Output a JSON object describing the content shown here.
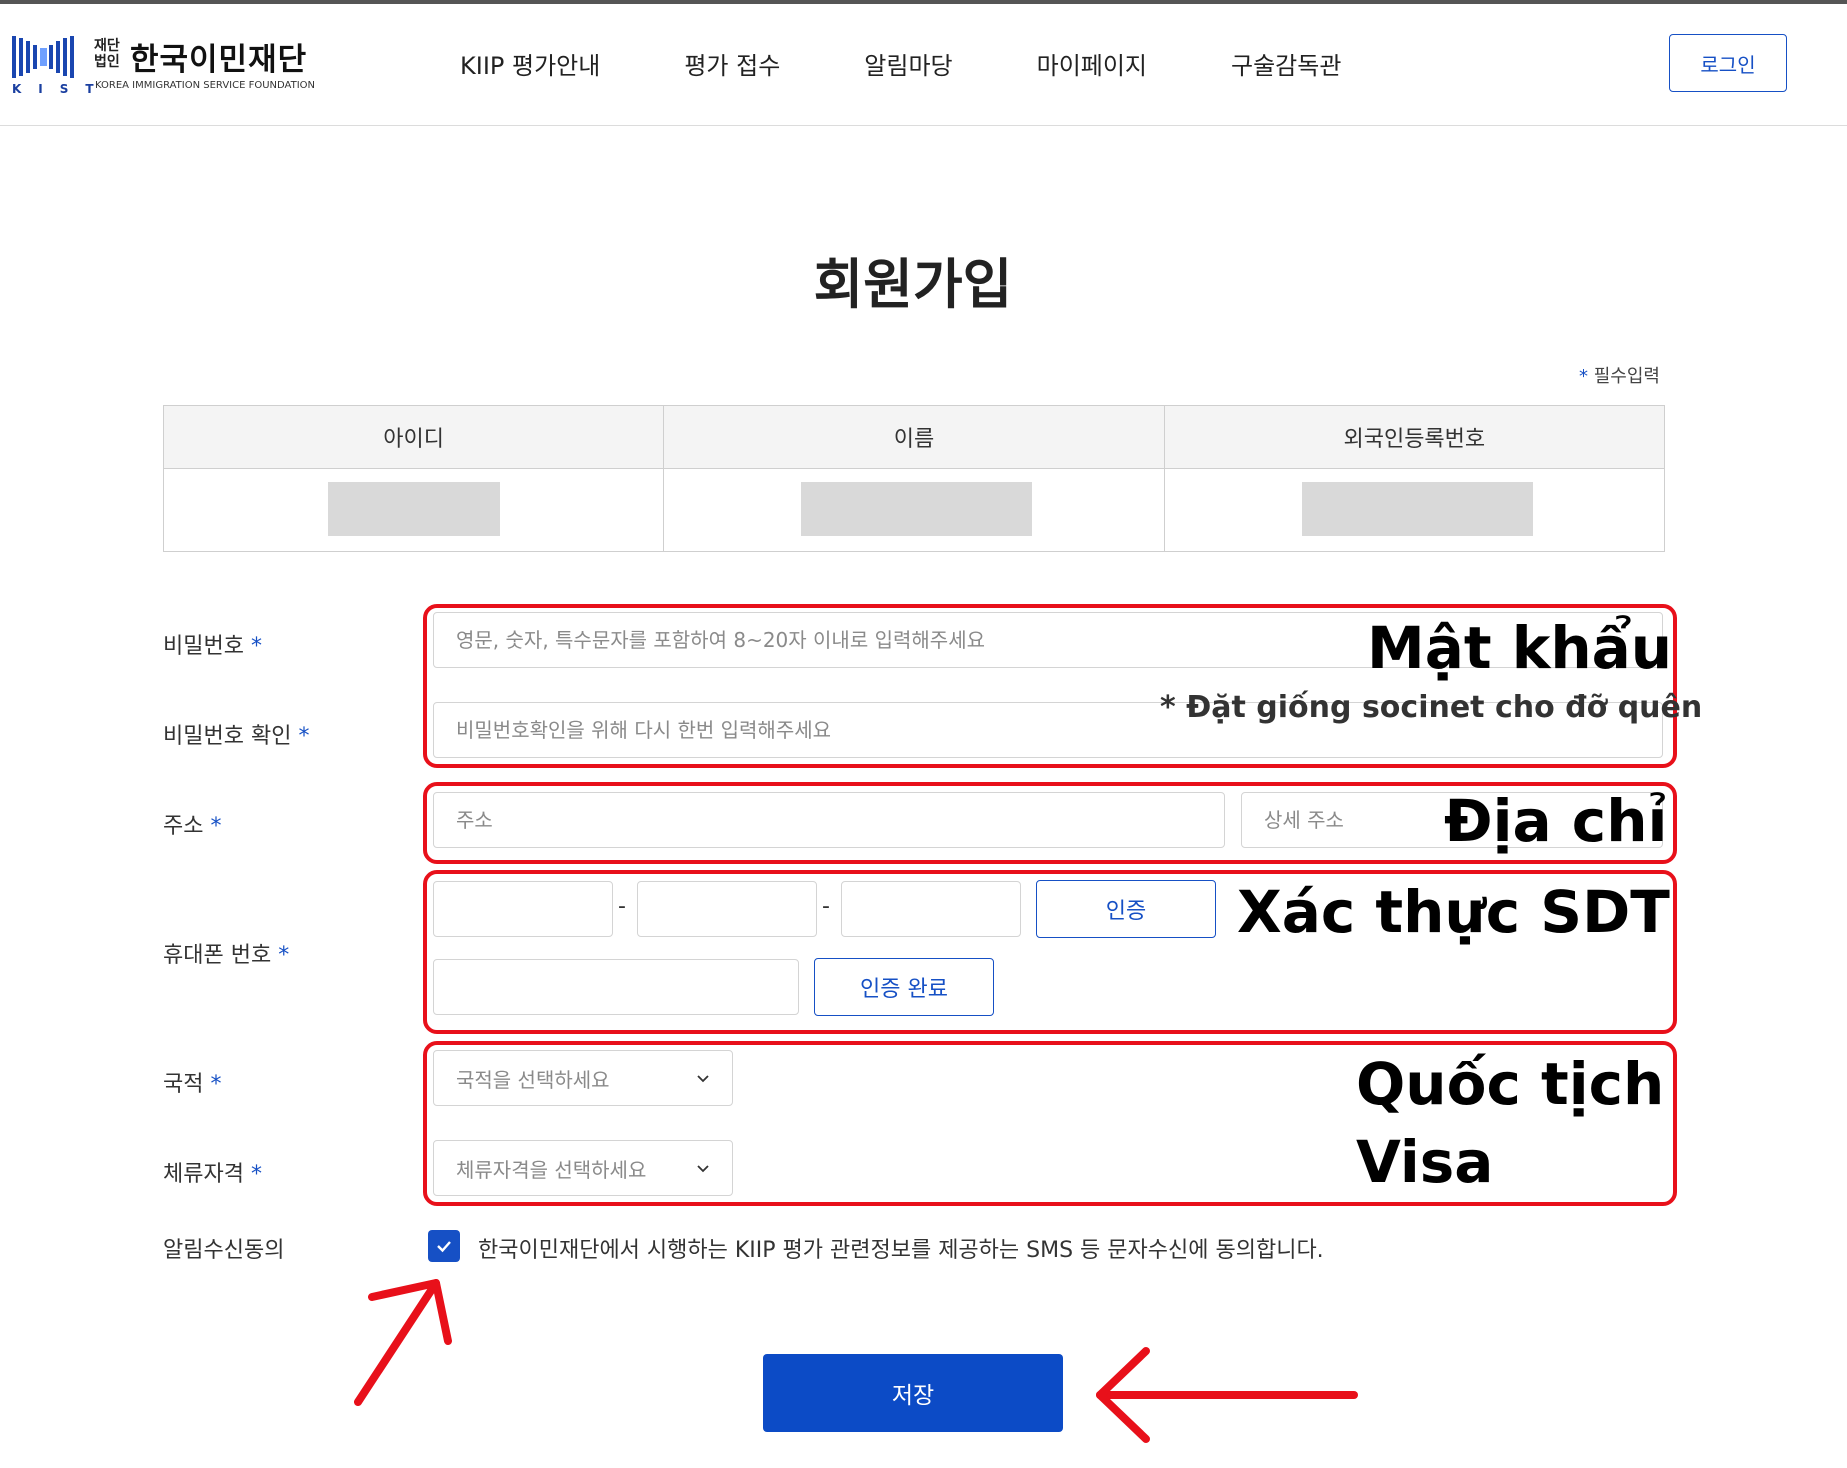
{
  "header": {
    "logo_prefix_line1": "재단",
    "logo_prefix_line2": "법인",
    "logo_title": "한국이민재단",
    "logo_letters": "KIST",
    "logo_subtitle": "KOREA IMMIGRATION SERVICE FOUNDATION",
    "nav": [
      "KIIP 평가안내",
      "평가 접수",
      "알림마당",
      "마이페이지",
      "구술감독관"
    ],
    "login_label": "로그인"
  },
  "page": {
    "title": "회원가입",
    "required_note_star": "*",
    "required_note": "필수입력"
  },
  "info_table": {
    "headers": [
      "아이디",
      "이름",
      "외국인등록번호"
    ]
  },
  "form": {
    "required_star": "*",
    "password_label": "비밀번호",
    "password_placeholder": "영문, 숫자, 특수문자를 포함하여 8~20자 이내로 입력해주세요",
    "password_confirm_label": "비밀번호 확인",
    "password_confirm_placeholder": "비밀번호확인을 위해 다시 한번 입력해주세요",
    "address_label": "주소",
    "address_placeholder": "주소",
    "address_detail_placeholder": "상세 주소",
    "phone_label": "휴대폰 번호",
    "phone_dash": "-",
    "verify_button": "인증",
    "verify_done_button": "인증 완료",
    "nationality_label": "국적",
    "nationality_placeholder": "국적을 선택하세요",
    "visa_label": "체류자격",
    "visa_placeholder": "체류자격을 선택하세요",
    "consent_label": "알림수신동의",
    "consent_checked": true,
    "consent_text": "한국이민재단에서 시행하는 KIIP 평가 관련정보를 제공하는 SMS 등 문자수신에 동의합니다.",
    "save_button": "저장"
  },
  "annotations": {
    "password_title": "Mật khẩu",
    "password_note": "* Đặt giống socinet cho đỡ quên",
    "address": "Địa chỉ",
    "phone": "Xác thực SDT",
    "nationality": "Quốc tịch",
    "visa": "Visa",
    "color": "#e8101a"
  },
  "colors": {
    "primary": "#1650c5",
    "save_button": "#0c4bc6",
    "placeholder_gray": "#d9d9d9"
  }
}
